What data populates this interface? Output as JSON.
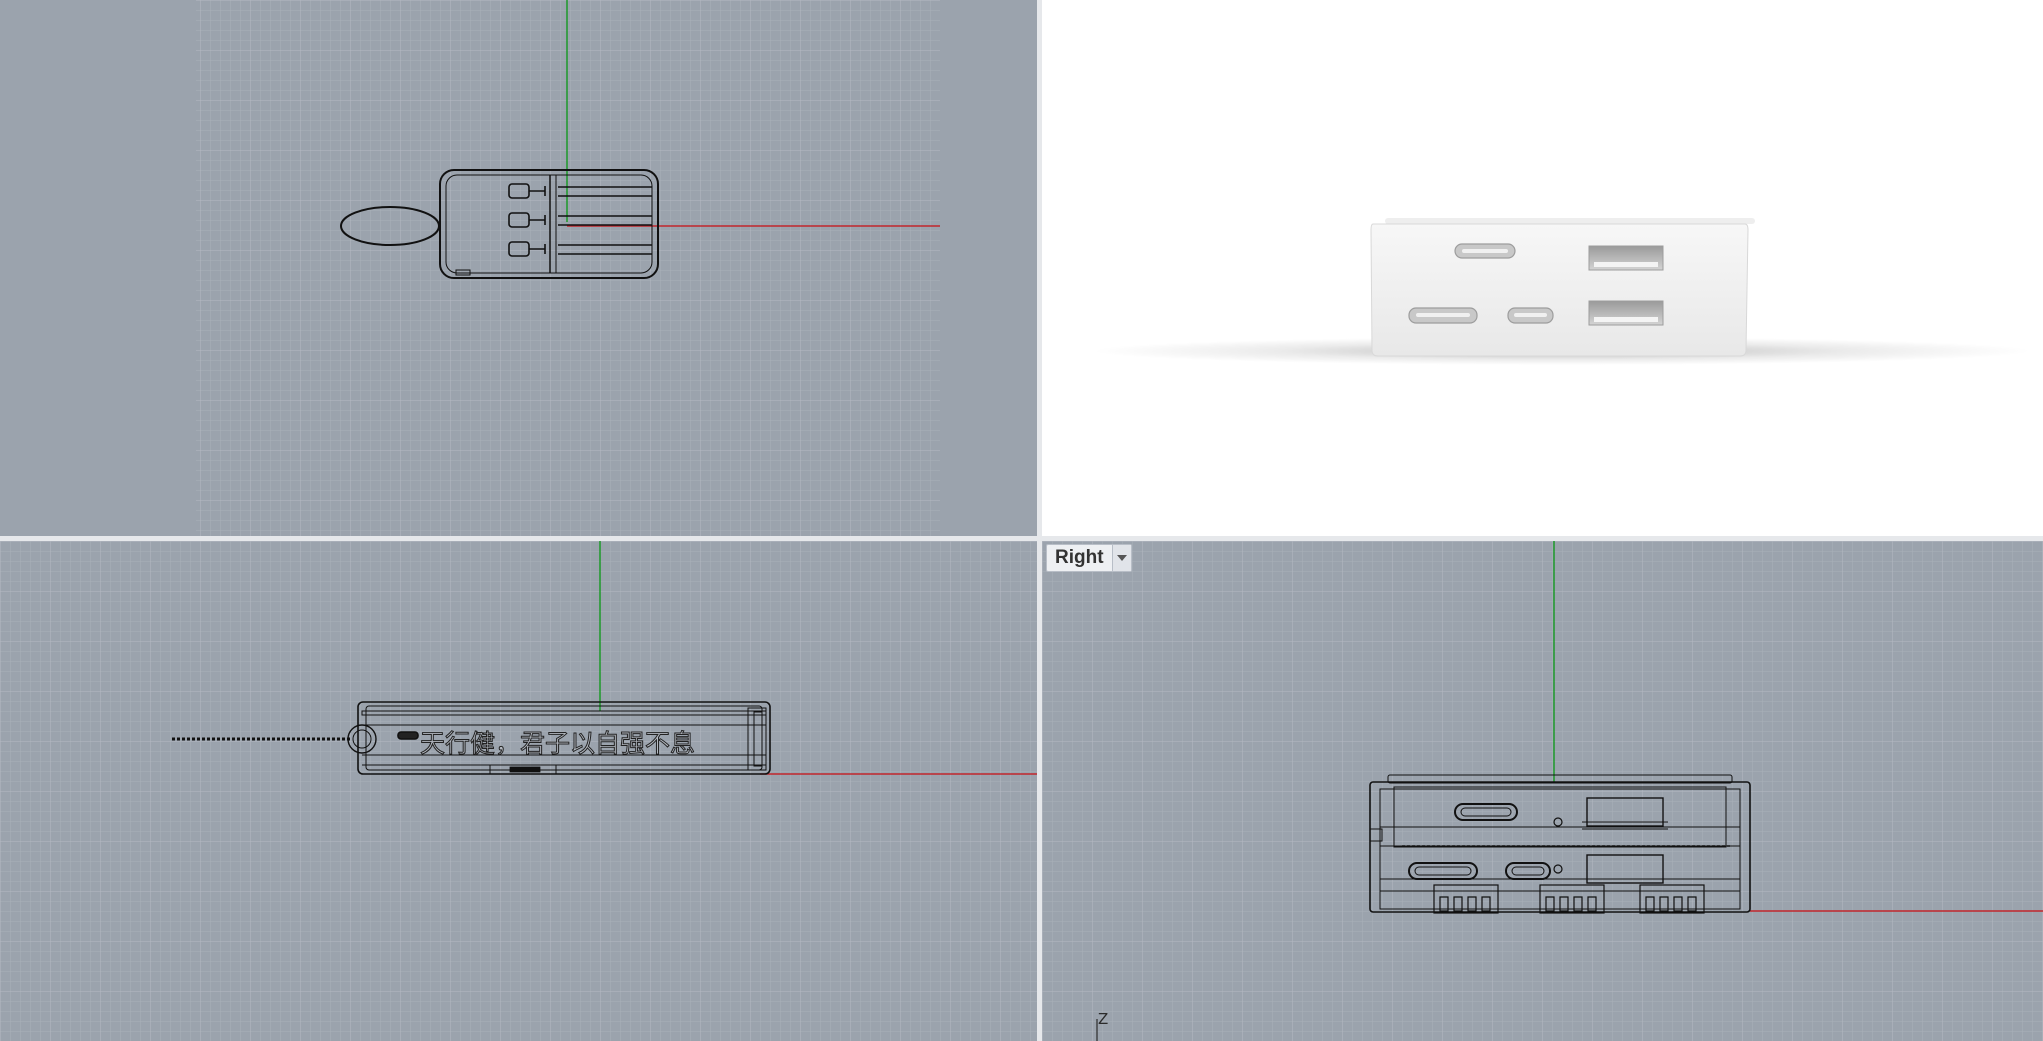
{
  "viewports": {
    "top_left": {
      "title": ""
    },
    "perspective": {
      "title": ""
    },
    "front": {
      "title": "",
      "engraved_text": "天行健，君子以自强不息"
    },
    "right": {
      "title": "Right",
      "axis_label": "Z"
    }
  },
  "colors": {
    "grid_bg": "#9ba3ad",
    "grid_line": "#a9b0b9",
    "grid_major": "#b4bac2",
    "x_axis": "#c2262c",
    "y_axis": "#1d9a2a",
    "wire": "#111111",
    "separator": "#e6e8eb",
    "render_bg": "#ffffff"
  }
}
